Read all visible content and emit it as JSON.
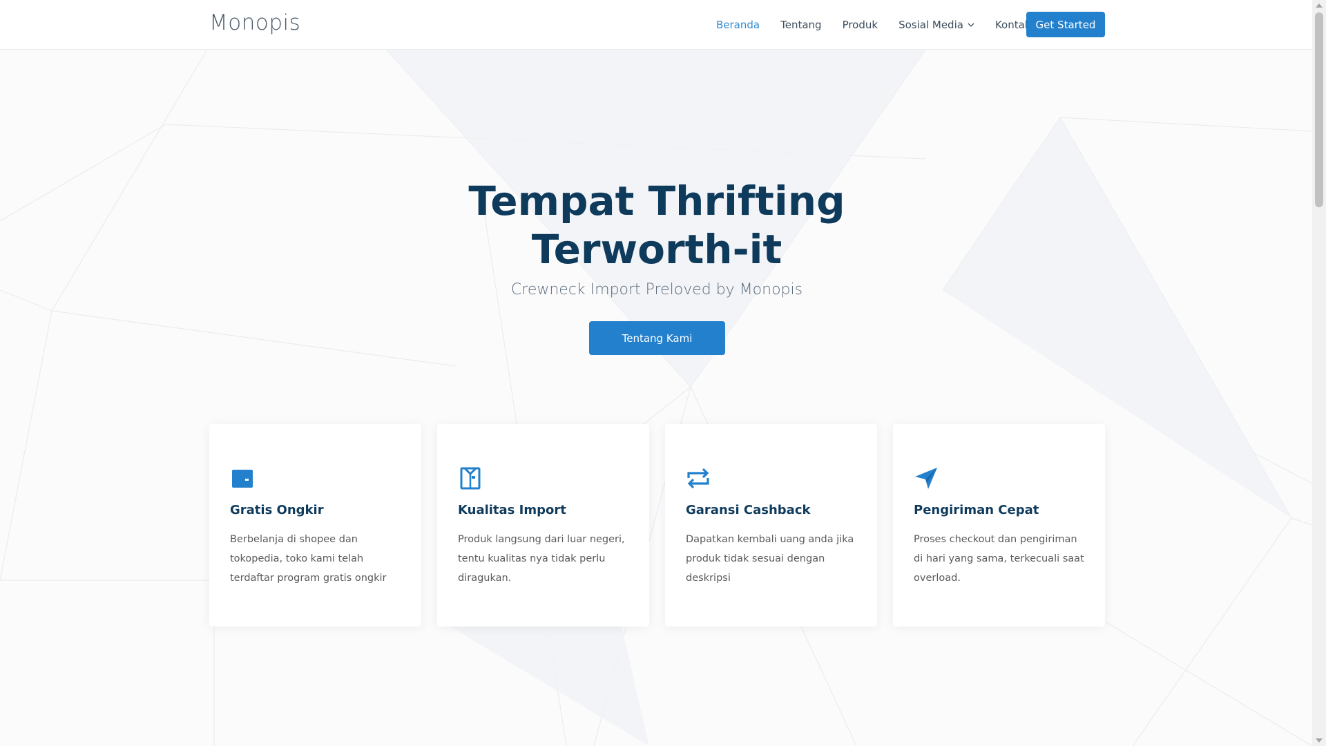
{
  "header": {
    "logo": "Monopis",
    "nav": [
      {
        "label": "Beranda",
        "active": true
      },
      {
        "label": "Tentang",
        "active": false
      },
      {
        "label": "Produk",
        "active": false
      },
      {
        "label": "Sosial Media",
        "active": false,
        "dropdown": true
      },
      {
        "label": "Kontak",
        "active": false
      }
    ],
    "cta_label": "Get Started"
  },
  "hero": {
    "title": "Tempat Thrifting Terworth-it",
    "subtitle": "Crewneck Import Preloved by Monopis",
    "button_label": "Tentang Kami"
  },
  "features": [
    {
      "icon": "wallet-icon",
      "title": "Gratis Ongkir",
      "text": "Berbelanja di shopee dan tokopedia, toko kami telah terdaftar program gratis ongkir"
    },
    {
      "icon": "shirt-icon",
      "title": "Kualitas Import",
      "text": "Produk langsung dari luar negeri, tentu kualitas nya tidak perlu diragukan."
    },
    {
      "icon": "repeat-icon",
      "title": "Garansi Cashback",
      "text": "Dapatkan kembali uang anda jika produk tidak sesuai dengan deskripsi"
    },
    {
      "icon": "send-icon",
      "title": "Pengiriman Cepat",
      "text": "Proses checkout dan pengiriman di hari yang sama, terkecuali saat overload."
    }
  ],
  "colors": {
    "accent": "#2280cc",
    "heading": "#0e3a5c",
    "nav_active": "#2f8bd3"
  }
}
